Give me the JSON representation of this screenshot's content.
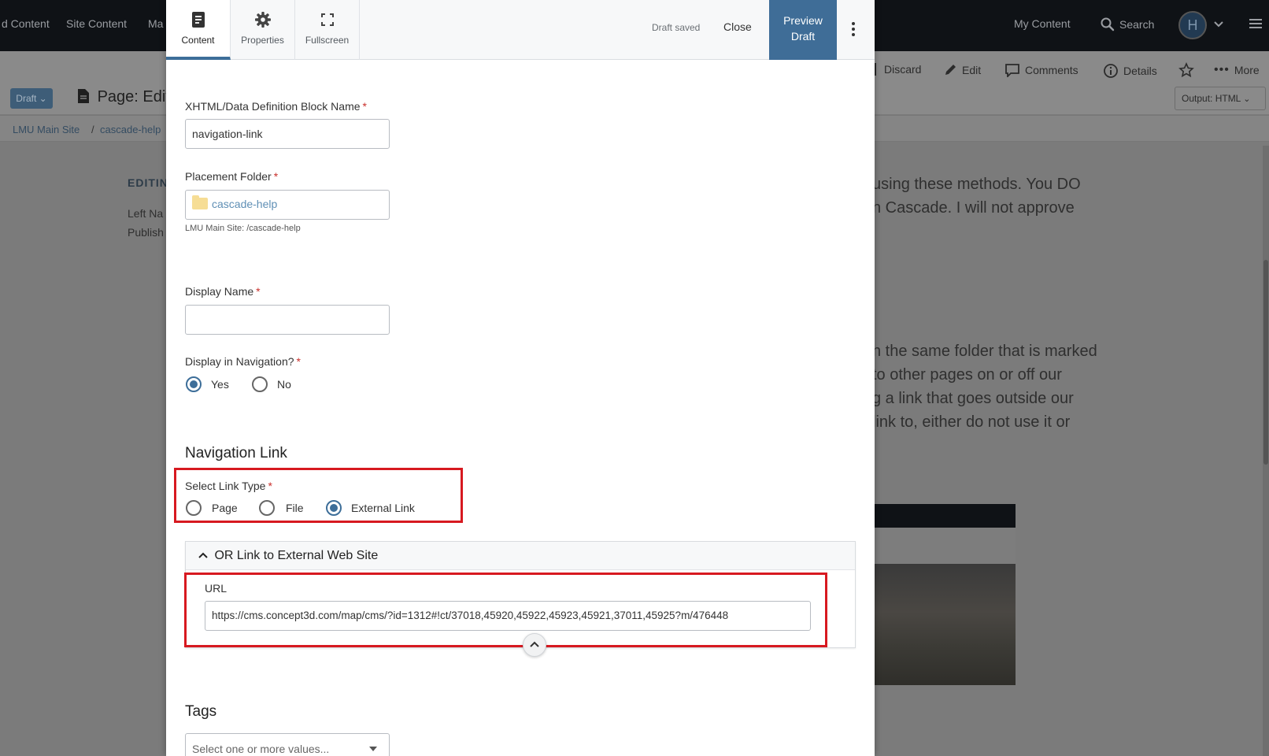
{
  "background": {
    "topnav": {
      "items": [
        "d Content",
        "Site Content",
        "Ma"
      ],
      "my_content": "My Content",
      "search": "Search",
      "avatar_initial": "H"
    },
    "toolbar": {
      "discard": "Discard",
      "edit": "Edit",
      "comments": "Comments",
      "details": "Details",
      "more": "More"
    },
    "draft_pill": "Draft",
    "page_title": "Page: Editing",
    "output_select": "Output: HTML",
    "breadcrumb": [
      "LMU Main Site",
      "/",
      "cascade-help"
    ],
    "left_heading": "EDITIN",
    "left_lines": [
      "Left Na",
      "Publish"
    ],
    "right_text_top": [
      "using these methods.  You DO",
      "n Cascade.  I will not approve"
    ],
    "right_text_mid": [
      "n the same folder that is marked",
      "to other pages on or off our",
      "g a link that goes outside our",
      "link to, either do not use it or"
    ]
  },
  "modal": {
    "tabs": [
      {
        "label": "Content",
        "icon": "document-icon",
        "active": true
      },
      {
        "label": "Properties",
        "icon": "gear-icon",
        "active": false
      },
      {
        "label": "Fullscreen",
        "icon": "fullscreen-icon",
        "active": false
      }
    ],
    "status": "Draft saved",
    "close_label": "Close",
    "preview_label_1": "Preview",
    "preview_label_2": "Draft",
    "fields": {
      "block_name_label": "XHTML/Data Definition Block Name",
      "block_name_value": "navigation-link",
      "placement_label": "Placement Folder",
      "placement_value": "cascade-help",
      "placement_path": "LMU Main Site: /cascade-help",
      "display_name_label": "Display Name",
      "display_name_value": "",
      "display_nav_label": "Display in Navigation?",
      "display_nav_options": [
        "Yes",
        "No"
      ],
      "display_nav_selected": "Yes"
    },
    "navigation_link": {
      "heading": "Navigation Link",
      "link_type_label": "Select Link Type",
      "link_type_options": [
        "Page",
        "File",
        "External Link"
      ],
      "link_type_selected": "External Link",
      "external_panel_title": "OR Link to External Web Site",
      "url_label": "URL",
      "url_value": "https://cms.concept3d.com/map/cms/?id=1312#!ct/37018,45920,45922,45923,45921,37011,45925?m/476448"
    },
    "tags": {
      "heading": "Tags",
      "placeholder": "Select one or more values..."
    }
  },
  "colors": {
    "accent": "#3f6d97",
    "required": "#c9302c",
    "highlight_box": "#d71920"
  }
}
